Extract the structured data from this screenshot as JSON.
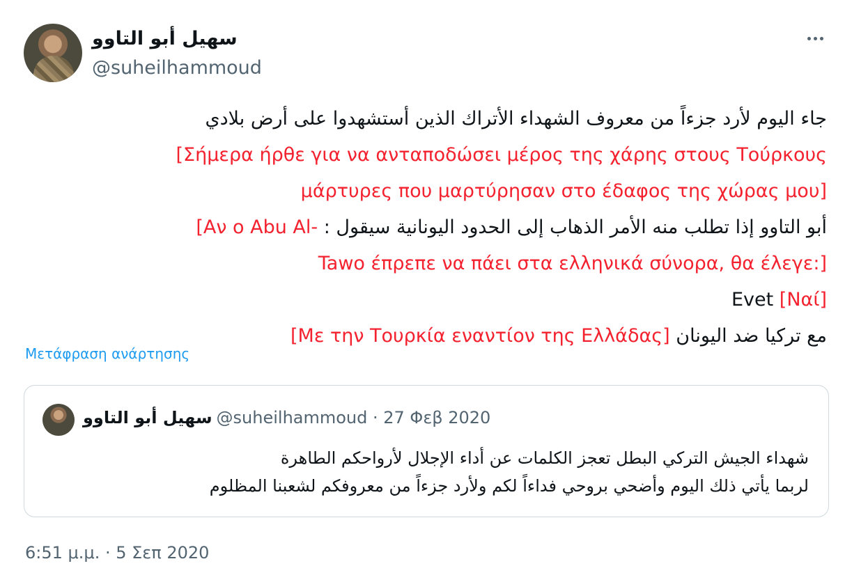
{
  "header": {
    "display_name": "سهيل أبو التاوو",
    "handle": "@suheilhammoud"
  },
  "body": {
    "line1": "جاء اليوم لأرد جزءاً من معروف الشهداء الأتراك الذين أستشهدوا على أرض بلادي",
    "line2": "[Σήμερα ήρθε για να ανταποδώσει μέρος της χάρης στους Τούρκους",
    "line3": "μάρτυρες που μαρτύρησαν στο έδαφος της χώρας μου]",
    "line4_ar": "أبو التاوو إذا تطلب منه الأمر الذهاب إلى الحدود اليونانية سيقول :",
    "line4_red": "[Αν ο Abu Al-",
    "line5": "Tawo έπρεπε να πάει στα ελληνικά σύνορα, θα έλεγε:]",
    "line6_black": "Evet",
    "line6_red": "[Ναί]",
    "line7_ar": "مع تركيا ضد اليونان",
    "line7_red": "[Με την Τουρκία εναντίον της Ελλάδας]"
  },
  "translate_link": "Μετάφραση ανάρτησης",
  "quote": {
    "name": "سهيل أبو التاوو",
    "meta": "@suheilhammoud · 27 Φεβ 2020",
    "line1": "شهداء الجيش التركي البطل تعجز الكلمات عن أداء الإجلال لأرواحكم الطاهرة",
    "line2": "لربما يأتي ذلك اليوم وأضحي بروحي فداءاً لكم ولأرد جزءاً من معروفكم لشعبنا المظلوم"
  },
  "timestamp": "6:51 μ.μ. · 5 Σεπ 2020",
  "icons": {
    "more": "more-horizontal-icon"
  },
  "colors": {
    "translation_red": "#f4212e",
    "link_blue": "#1d9bf0",
    "secondary_text": "#536471"
  }
}
